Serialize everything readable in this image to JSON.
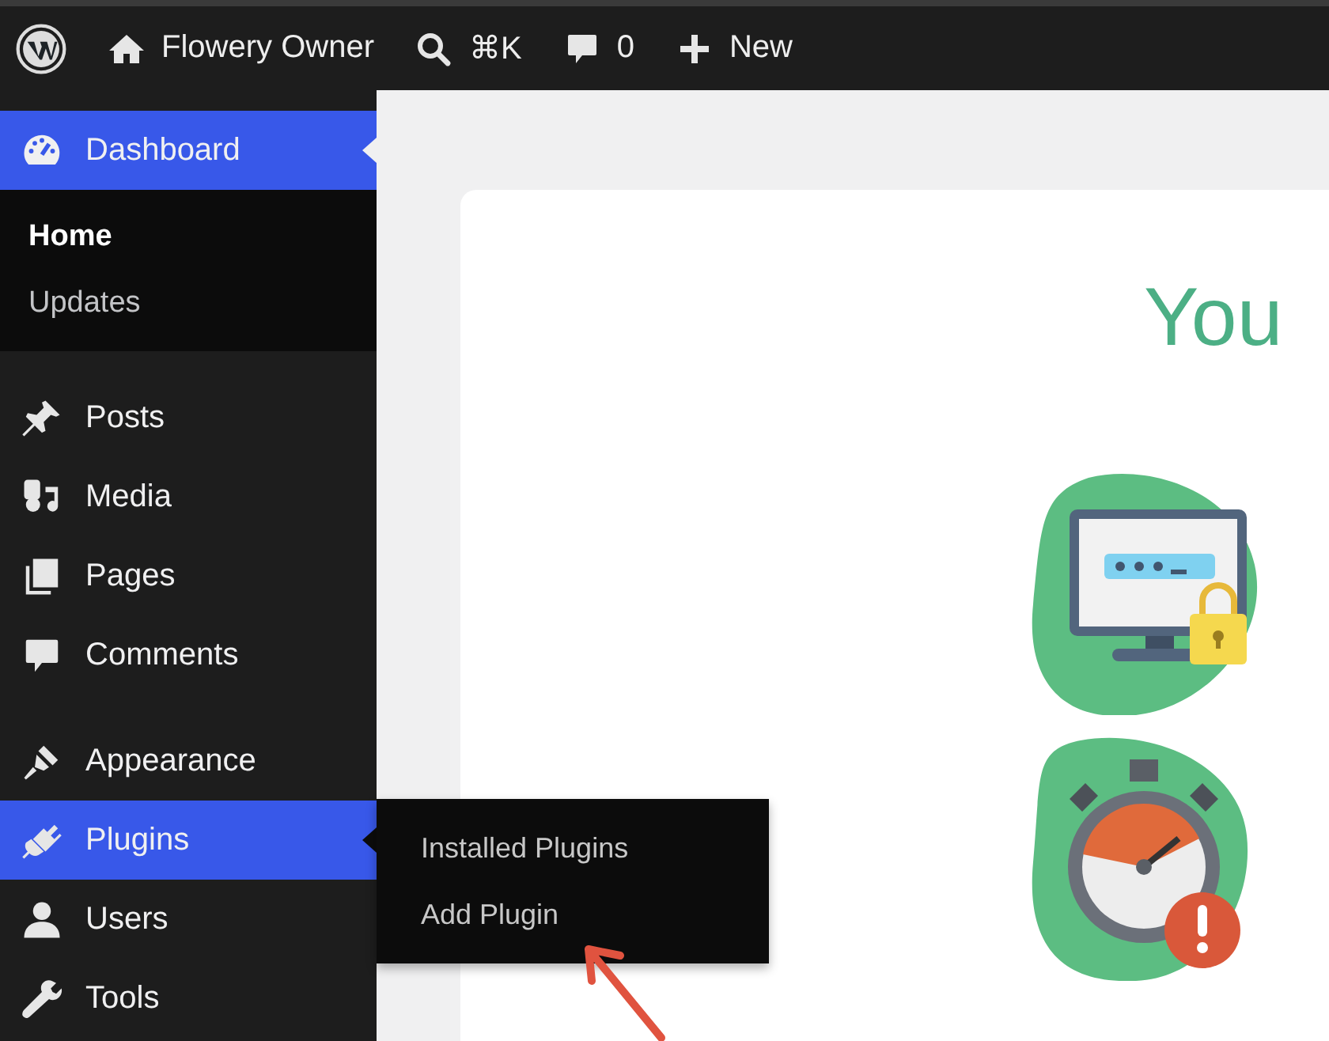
{
  "top_bar": {
    "site_name": "Flowery Owner",
    "search_shortcut": "⌘K",
    "comment_count": "0",
    "new_label": "New"
  },
  "sidebar": {
    "groups": [
      {
        "items": [
          {
            "label": "Dashboard",
            "selected": true,
            "submenu": [
              {
                "label": "Home",
                "selected": true
              },
              {
                "label": "Updates",
                "selected": false
              }
            ]
          }
        ]
      },
      {
        "items": [
          {
            "label": "Posts",
            "selected": false
          },
          {
            "label": "Media",
            "selected": false
          },
          {
            "label": "Pages",
            "selected": false
          },
          {
            "label": "Comments",
            "selected": false
          }
        ]
      },
      {
        "items": [
          {
            "label": "Appearance",
            "selected": false
          },
          {
            "label": "Plugins",
            "selected": true,
            "flyout": [
              {
                "label": "Installed Plugins"
              },
              {
                "label": "Add Plugin"
              }
            ]
          },
          {
            "label": "Users",
            "selected": false
          },
          {
            "label": "Tools",
            "selected": false
          }
        ]
      }
    ]
  },
  "content": {
    "heading": "You"
  }
}
